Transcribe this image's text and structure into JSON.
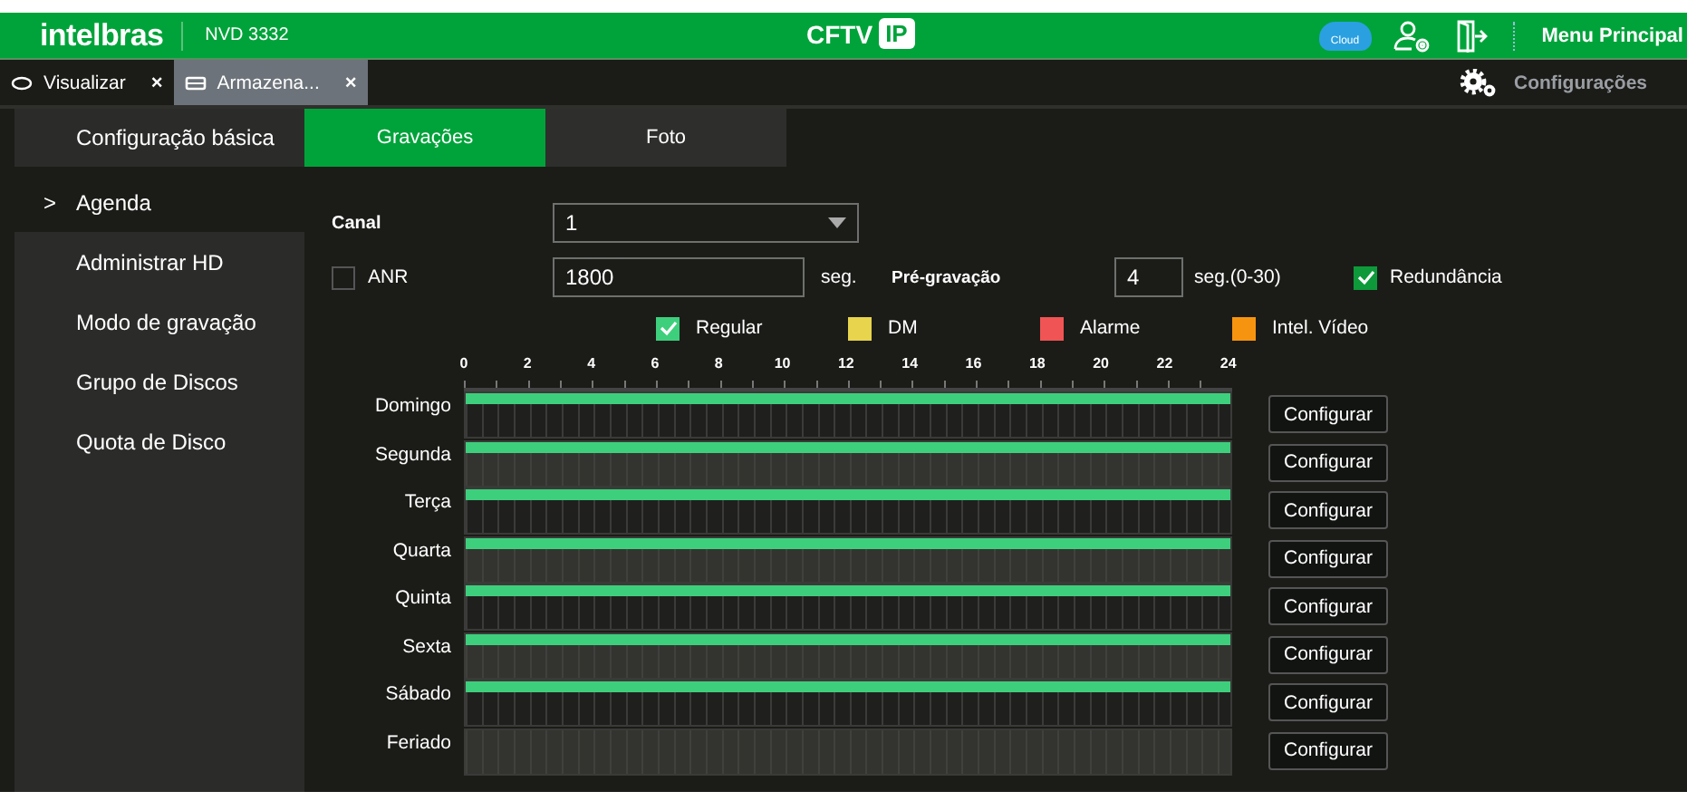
{
  "header": {
    "brand": "intelbras",
    "model": "NVD 3332",
    "logo_text": "CFTV",
    "logo_badge": "IP",
    "cloud_label": "Cloud",
    "menu": "Menu Principal"
  },
  "tabs": [
    {
      "label": "Visualizar",
      "close": "×",
      "selected": false
    },
    {
      "label": "Armazena...",
      "close": "×",
      "selected": true
    }
  ],
  "settings_label": "Configurações",
  "sidebar": {
    "title": "Configuração básica",
    "items": [
      {
        "label": "Agenda",
        "marker": ">",
        "selected": true
      },
      {
        "label": "Administrar HD",
        "selected": false
      },
      {
        "label": "Modo de gravação",
        "selected": false
      },
      {
        "label": "Grupo de Discos",
        "selected": false
      },
      {
        "label": "Quota de Disco",
        "selected": false
      }
    ]
  },
  "subtabs": [
    {
      "label": "Gravações",
      "selected": true
    },
    {
      "label": "Foto",
      "selected": false
    }
  ],
  "form": {
    "channel": {
      "label": "Canal",
      "value": "1"
    },
    "anr": {
      "label": "ANR",
      "checked": false,
      "value": "1800",
      "unit": "seg."
    },
    "pre_record": {
      "label": "Pré-gravação",
      "value": "4",
      "unit": "seg.(0-30)"
    },
    "redundancy": {
      "label": "Redundância",
      "checked": true
    }
  },
  "legend": [
    {
      "label": "Regular",
      "color": "#3ecf7d",
      "checked": true
    },
    {
      "label": "DM",
      "color": "#e8d44d",
      "checked": false
    },
    {
      "label": "Alarme",
      "color": "#f05454",
      "checked": false
    },
    {
      "label": "Intel. Vídeo",
      "color": "#f7940f",
      "checked": false
    }
  ],
  "schedule": {
    "hours": [
      "0",
      "2",
      "4",
      "6",
      "8",
      "10",
      "12",
      "14",
      "16",
      "18",
      "20",
      "22",
      "24"
    ],
    "days": [
      {
        "name": "Domingo",
        "level": 1,
        "button": "Configurar"
      },
      {
        "name": "Segunda",
        "level": 1,
        "button": "Configurar"
      },
      {
        "name": "Terça",
        "level": 1,
        "button": "Configurar"
      },
      {
        "name": "Quarta",
        "level": 1,
        "button": "Configurar"
      },
      {
        "name": "Quinta",
        "level": 1,
        "button": "Configurar"
      },
      {
        "name": "Sexta",
        "level": 1,
        "button": "Configurar"
      },
      {
        "name": "Sábado",
        "level": 1,
        "button": "Configurar"
      },
      {
        "name": "Feriado",
        "level": 0,
        "button": "Configurar"
      }
    ]
  }
}
